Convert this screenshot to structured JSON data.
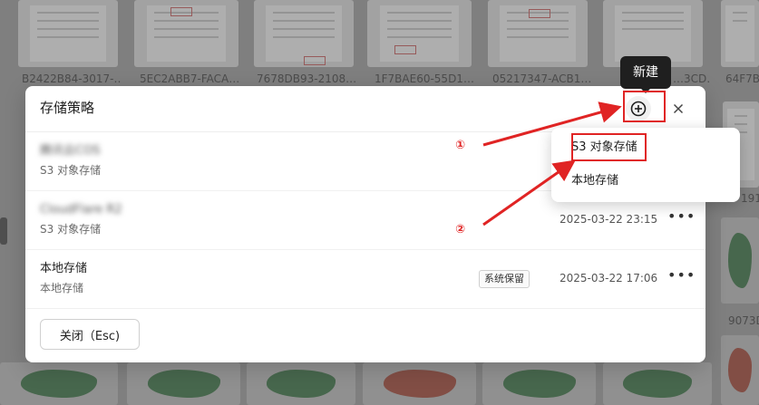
{
  "background": {
    "captions": [
      "B2422B84-3017-…",
      "5EC2ABB7-FACA…",
      "7678DB93-2108…",
      "1F7BAE60-55D1…",
      "05217347-ACB1…",
      "…3CD…",
      "64F7B"
    ],
    "right_edge_labels": [
      "191",
      "9073D"
    ]
  },
  "tooltip": {
    "text": "新建"
  },
  "modal": {
    "title": "存储策略",
    "rows": [
      {
        "name": "腾讯云COS",
        "type": "S3 对象存储",
        "badge": "",
        "date": "",
        "blurred": true
      },
      {
        "name": "CloudFlare R2",
        "type": "S3 对象存储",
        "badge": "",
        "date": "2025-03-22 23:15",
        "blurred": true
      },
      {
        "name": "本地存储",
        "type": "本地存储",
        "badge": "系统保留",
        "date": "2025-03-22 17:06",
        "blurred": false
      }
    ],
    "more_label": "•••",
    "footer": {
      "close_label": "关闭（Esc)"
    }
  },
  "dropdown": {
    "items": [
      "S3 对象存储",
      "本地存储"
    ]
  },
  "annotations": {
    "step1": "①",
    "step2": "②",
    "color": "#e02424"
  }
}
